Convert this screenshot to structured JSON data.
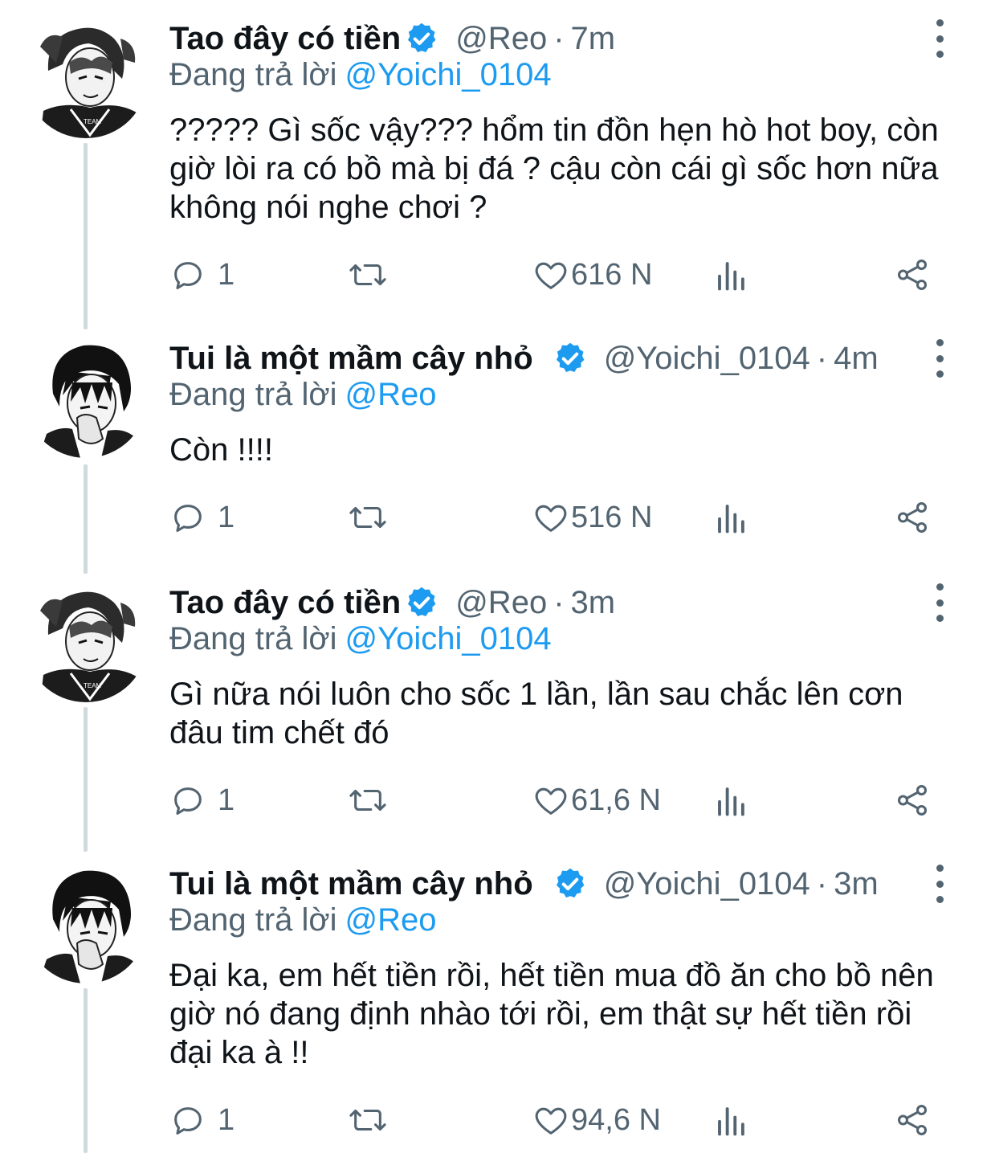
{
  "tweets": [
    {
      "name": "Tao đây có tiền",
      "handle": "@Reo",
      "sep": "·",
      "time": "7m",
      "replying_label": "Đang trả lời",
      "replying_to": "@Yoichi_0104",
      "text": "????? Gì sốc vậy??? hổm tin đồn hẹn hò hot boy, còn giờ lòi ra có bồ mà bị đá ? cậu còn cái gì sốc hơn nữa không nói nghe chơi ?",
      "replies": "1",
      "likes": "616 N",
      "verified": true,
      "avatar_icon": "avatar-reo"
    },
    {
      "name": "Tui là một mầm cây nhỏ",
      "handle": "@Yoichi_0104",
      "sep": "·",
      "time": "4m",
      "replying_label": "Đang trả lời",
      "replying_to": "@Reo",
      "text": "Còn !!!!",
      "replies": "1",
      "likes": "516 N",
      "verified": true,
      "avatar_icon": "avatar-yoichi"
    },
    {
      "name": "Tao đây có tiền",
      "handle": "@Reo",
      "sep": "·",
      "time": "3m",
      "replying_label": "Đang trả lời",
      "replying_to": "@Yoichi_0104",
      "text": "Gì nữa nói luôn cho sốc 1 lần, lần sau chắc lên cơn đâu tim chết đó",
      "replies": "1",
      "likes": "61,6 N",
      "verified": true,
      "avatar_icon": "avatar-reo"
    },
    {
      "name": "Tui là một mầm cây nhỏ",
      "handle": "@Yoichi_0104",
      "sep": "·",
      "time": "3m",
      "replying_label": "Đang trả lời",
      "replying_to": "@Reo",
      "text": "Đại ka, em hết tiền rồi, hết tiền mua đồ ăn cho bồ nên giờ nó đang định nhào tới rồi, em thật sự hết tiền rồi đại ka à !!",
      "replies": "1",
      "likes": "94,6 N",
      "verified": true,
      "avatar_icon": "avatar-yoichi"
    }
  ],
  "colors": {
    "accent": "#1d9bf0",
    "muted": "#536471",
    "text": "#0f1419",
    "thread_line": "#cfd9de"
  },
  "icons": {
    "reply": "reply-icon",
    "retweet": "retweet-icon",
    "like": "heart-icon",
    "views": "views-icon",
    "share": "share-icon",
    "more": "more-vertical-icon",
    "verified": "verified-badge-icon"
  }
}
